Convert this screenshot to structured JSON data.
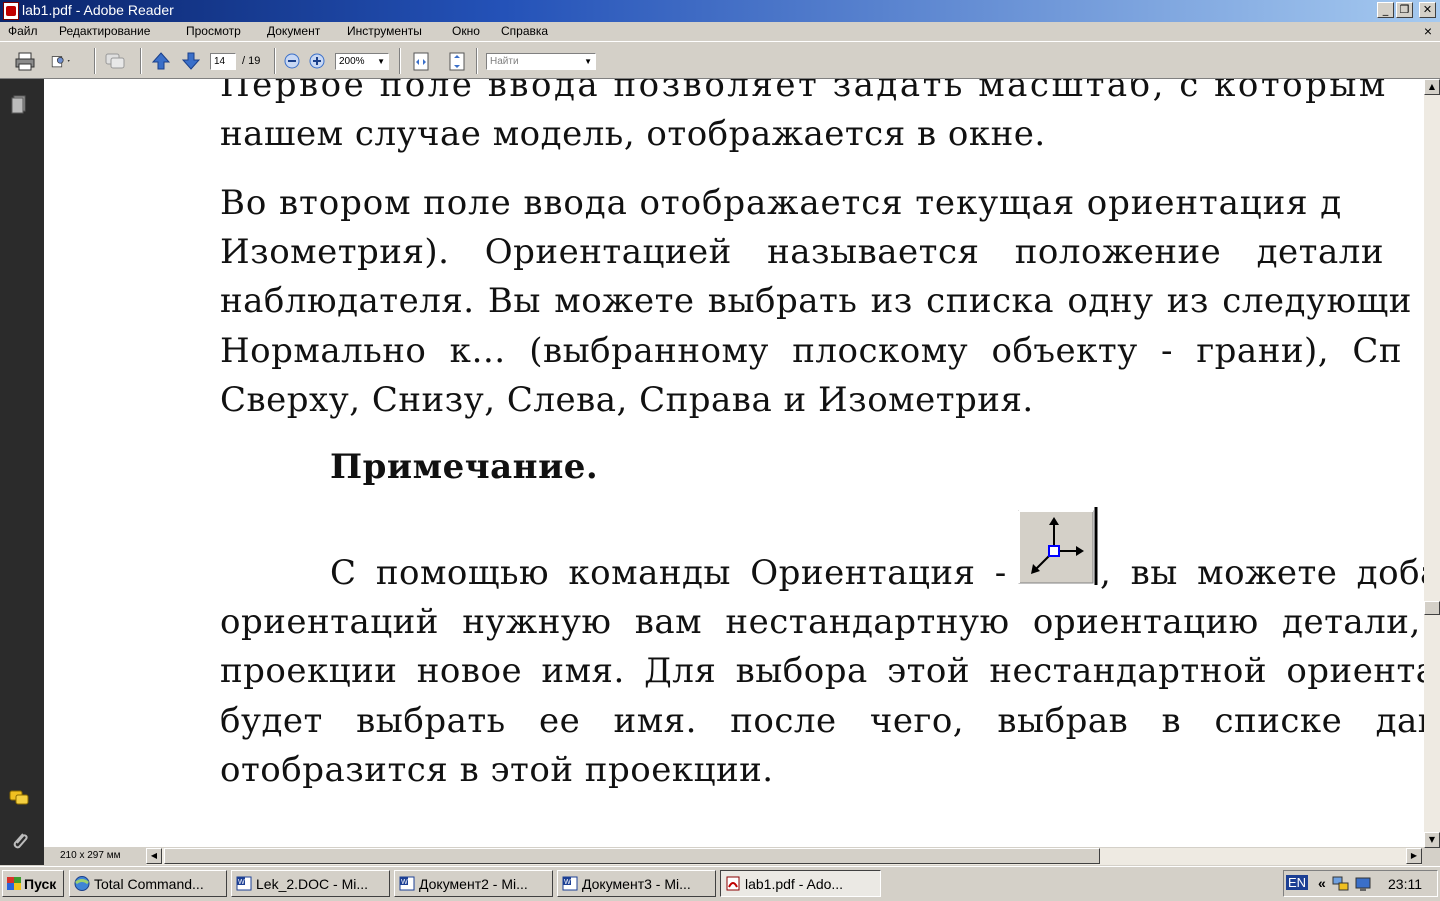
{
  "window": {
    "title": "lab1.pdf - Adobe Reader",
    "controls": {
      "minimize": "_",
      "maximize": "❐",
      "close": "✕"
    },
    "doc_close": "×"
  },
  "menu": [
    "Файл",
    "Редактирование",
    "Просмотр",
    "Документ",
    "Инструменты",
    "Окно",
    "Справка"
  ],
  "toolbar": {
    "page_current": "14",
    "page_total": "/ 19",
    "zoom": "200%",
    "search_placeholder": "Найти"
  },
  "document": {
    "lines": [
      "        Первое поле ввода позволяет задать масштаб, с которым",
      "нашем случае модель, отображается в окне.",
      "        Во втором поле ввода отображается текущая ориентация д",
      "Изометрия). Ориентацией называется положение детали",
      "наблюдателя. Вы можете выбрать из списка одну из следующи",
      "Нормально к… (выбранному плоскому объекту - грани), Сп",
      "Сверху, Снизу, Слева, Справа и Изометрия."
    ],
    "note_heading": "Примечание.",
    "para2_first_before": "С помощью команды Ориентация -",
    "para2_first_after": ", вы можете доба",
    "para2_lines": [
      "ориентаций нужную вам нестандартную ориентацию детали, н",
      "проекции новое имя. Для выбора этой нестандартной ориентац",
      "будет выбрать ее имя. после чего, выбрав в списке данно",
      "отобразится в этой проекции."
    ]
  },
  "status": {
    "page_size": "210 x 297 мм"
  },
  "taskbar": {
    "start": "Пуск",
    "tasks": [
      {
        "label": "Total Command...",
        "icon": "total-commander-icon"
      },
      {
        "label": "Lek_2.DOC - Mi...",
        "icon": "word-icon"
      },
      {
        "label": "Документ2 - Mi...",
        "icon": "word-icon"
      },
      {
        "label": "Документ3 - Mi...",
        "icon": "word-icon"
      },
      {
        "label": "lab1.pdf - Ado...",
        "icon": "pdf-icon",
        "active": true
      }
    ],
    "lang": "EN",
    "expand": "«",
    "clock": "23:11"
  },
  "colors": {
    "titlebar": "#0a246a",
    "navpanel": "#2b2b2b",
    "chrome": "#d4d0c8"
  }
}
